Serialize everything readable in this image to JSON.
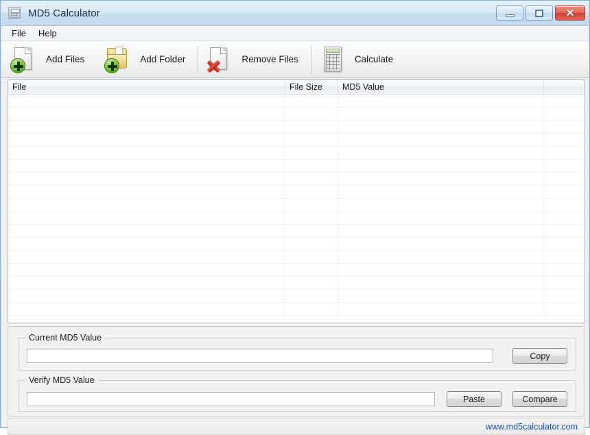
{
  "window": {
    "title": "MD5 Calculator",
    "icon": "calculator-app-icon",
    "controls": {
      "minimize": "minimize-icon",
      "maximize": "maximize-icon",
      "close": "✕"
    }
  },
  "menubar": {
    "items": [
      {
        "label": "File"
      },
      {
        "label": "Help"
      }
    ]
  },
  "toolbar": {
    "buttons": [
      {
        "label": "Add Files",
        "icon": "add-file-icon"
      },
      {
        "label": "Add Folder",
        "icon": "add-folder-icon"
      },
      {
        "label": "Remove Files",
        "icon": "remove-file-icon"
      },
      {
        "label": "Calculate",
        "icon": "calculator-icon"
      }
    ]
  },
  "listview": {
    "columns": [
      {
        "label": "File"
      },
      {
        "label": "File Size"
      },
      {
        "label": "MD5 Value"
      },
      {
        "label": ""
      }
    ],
    "rows": [],
    "empty": true,
    "row_count_visible": 17
  },
  "panel": {
    "current": {
      "group_title": "Current MD5 Value",
      "value": "",
      "placeholder": "",
      "copy_label": "Copy"
    },
    "verify": {
      "group_title": "Verify MD5 Value",
      "value": "",
      "placeholder": "",
      "paste_label": "Paste",
      "compare_label": "Compare"
    }
  },
  "statusbar": {
    "link_text": "www.md5calculator.com",
    "link_color": "#1b4ea8"
  },
  "theme": {
    "frame": "#b8d0e8",
    "titlebar_text": "#15314f",
    "close_button": "#cf3f33",
    "list_border": "#9fb6cc"
  }
}
